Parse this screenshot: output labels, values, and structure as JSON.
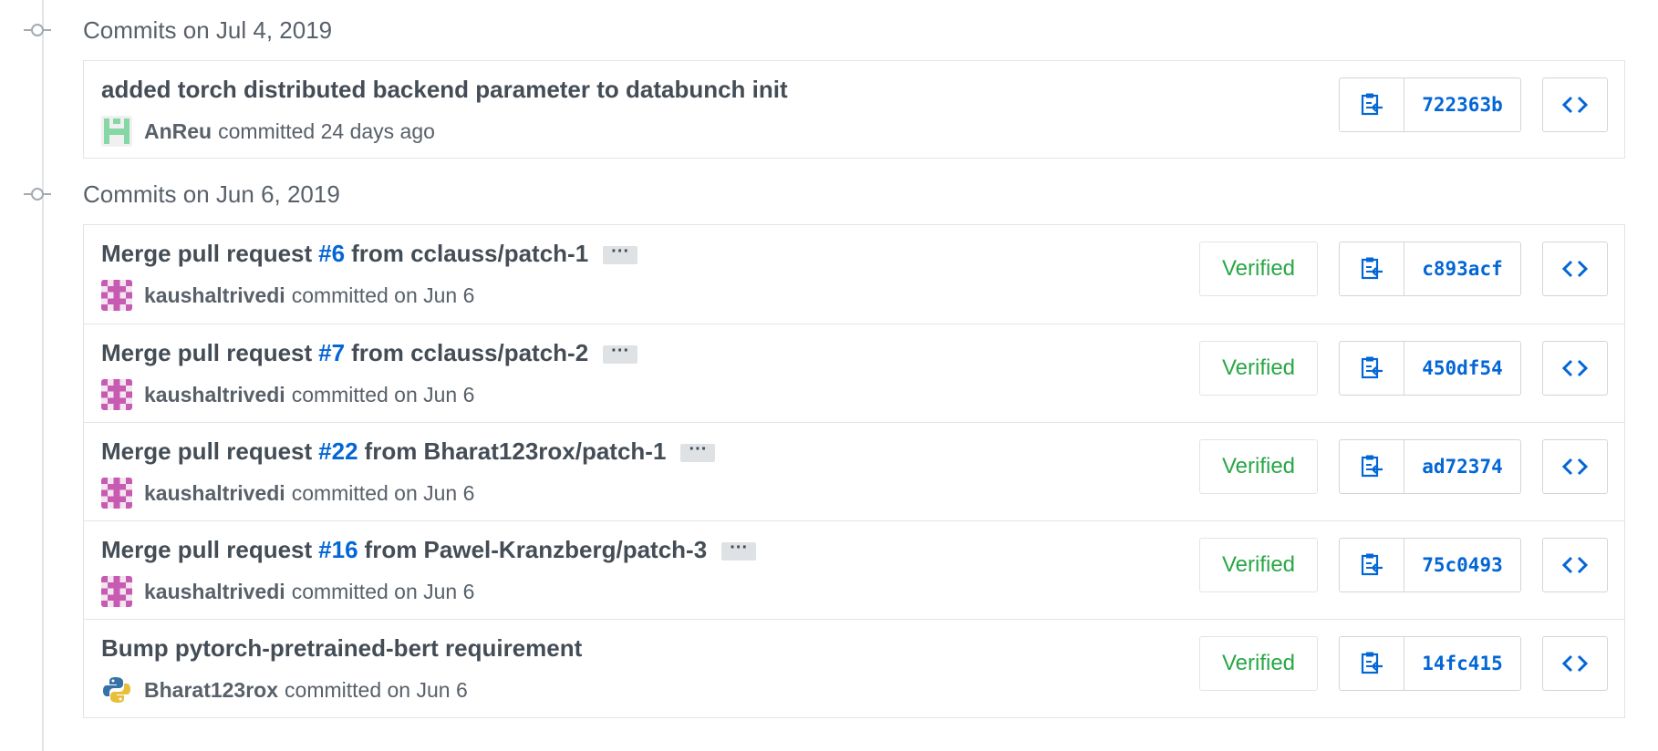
{
  "groups": [
    {
      "title": "Commits on Jul 4, 2019",
      "commits": [
        {
          "title": "added torch distributed backend parameter to databunch init",
          "author": "AnReu",
          "action": "committed 24 days ago",
          "sha": "722363b",
          "verified": false,
          "avatar": "anreu-avatar"
        }
      ]
    },
    {
      "title": "Commits on Jun 6, 2019",
      "commits": [
        {
          "title_prefix": "Merge pull request",
          "pr": "#6",
          "title_suffix": "from cclauss/patch-1",
          "author": "kaushaltrivedi",
          "action": "committed on Jun 6",
          "sha": "c893acf",
          "verified": true,
          "verified_label": "Verified"
        },
        {
          "title_prefix": "Merge pull request",
          "pr": "#7",
          "title_suffix": "from cclauss/patch-2",
          "author": "kaushaltrivedi",
          "action": "committed on Jun 6",
          "sha": "450df54",
          "verified": true,
          "verified_label": "Verified"
        },
        {
          "title_prefix": "Merge pull request",
          "pr": "#22",
          "title_suffix": "from Bharat123rox/patch-1",
          "author": "kaushaltrivedi",
          "action": "committed on Jun 6",
          "sha": "ad72374",
          "verified": true,
          "verified_label": "Verified"
        },
        {
          "title_prefix": "Merge pull request",
          "pr": "#16",
          "title_suffix": "from Pawel-Kranzberg/patch-3",
          "author": "kaushaltrivedi",
          "action": "committed on Jun 6",
          "sha": "75c0493",
          "verified": true,
          "verified_label": "Verified"
        },
        {
          "title": "Bump pytorch-pretrained-bert requirement",
          "author": "Bharat123rox",
          "action": "committed on Jun 6",
          "sha": "14fc415",
          "verified": true,
          "verified_label": "Verified",
          "avatar": "python-logo-avatar"
        }
      ]
    }
  ],
  "colors": {
    "link": "#0366d6",
    "verified": "#28a745",
    "muted": "#586069",
    "border": "#e1e4e8"
  }
}
